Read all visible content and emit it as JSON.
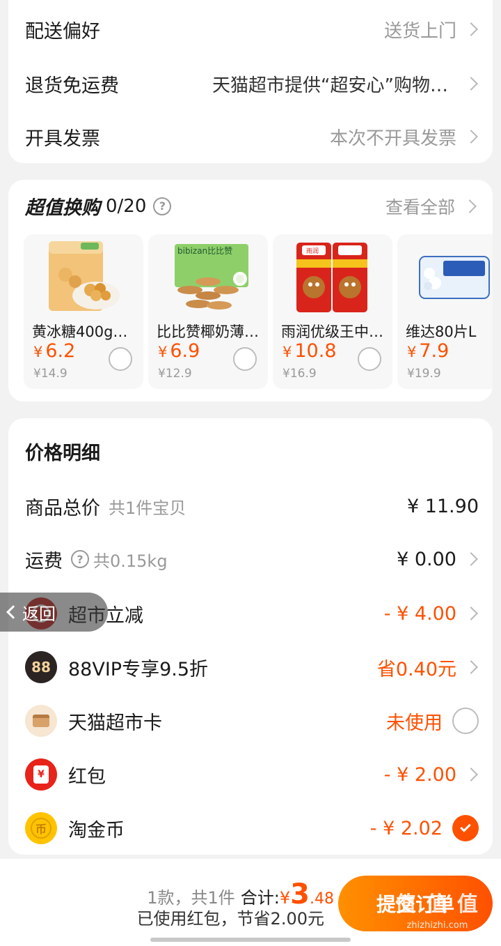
{
  "delivery": {
    "rows": [
      {
        "label": "配送偏好",
        "value": "送货上门"
      },
      {
        "label": "退货免运费",
        "value": "天猫超市提供“超安心”购物…"
      },
      {
        "label": "开具发票",
        "value": "本次不开具发票"
      }
    ]
  },
  "exchange": {
    "title": "超值换购",
    "count": "0/20",
    "help": "?",
    "view_all": "查看全部",
    "items": [
      {
        "name": "黄冰糖400g…",
        "yen": "¥",
        "price": "6.2",
        "original": "¥14.9"
      },
      {
        "name": "比比赞椰奶薄…",
        "yen": "¥",
        "price": "6.9",
        "original": "¥12.9",
        "brand": "bibizan比比赞"
      },
      {
        "name": "雨润优级王中…",
        "yen": "¥",
        "price": "10.8",
        "original": "¥16.9",
        "brand": "雨润"
      },
      {
        "name": "维达80片L",
        "yen": "¥",
        "price": "7.9",
        "original": "¥19.9"
      }
    ]
  },
  "price_detail": {
    "title": "价格明细",
    "goods_total": {
      "label": "商品总价",
      "sub": "共1件宝贝",
      "value": "¥ 11.90"
    },
    "shipping": {
      "label": "运费",
      "sub": "共0.15kg",
      "value": "¥ 0.00"
    },
    "discounts": [
      {
        "label": "超市立减",
        "value": "- ¥ 4.00"
      },
      {
        "label": "88VIP专享9.5折",
        "value": "省0.40元",
        "badge": "88"
      },
      {
        "label": "天猫超市卡",
        "value": "未使用"
      },
      {
        "label": "红包",
        "value": "- ¥ 2.00",
        "badge": "¥"
      },
      {
        "label": "淘金币",
        "value": "- ¥ 2.02",
        "badge": "币"
      }
    ]
  },
  "back_button": {
    "label": "返回"
  },
  "footer": {
    "count_text": "1款，共1件",
    "total_label": "合计:",
    "yen": "¥",
    "total_int": "3",
    "total_dec": ".48",
    "saving": "已使用红包，节省2.00元",
    "submit": "提交订单",
    "watermark": "值 值 值",
    "watermark_url": "zhizhizhi.com"
  },
  "colors": {
    "accent": "#ff5000",
    "background": "#f2f2f2",
    "vip_badge": "#2b2422",
    "coin": "#ffc300",
    "redpacket": "#e8231a"
  }
}
